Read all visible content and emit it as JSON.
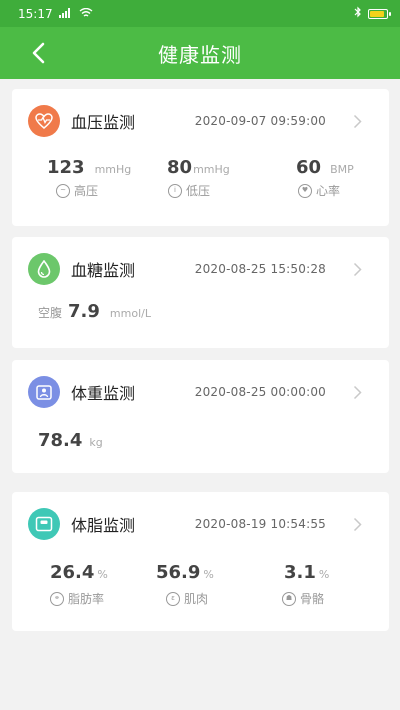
{
  "status_bar": {
    "time": "15:17",
    "signal_icon": "signal-icon",
    "wifi_icon": "wifi-icon",
    "bluetooth_icon": "bluetooth-icon",
    "battery_icon": "battery-icon",
    "battery_level": 0.85
  },
  "header": {
    "title": "健康监测",
    "back_icon": "chevron-left-icon"
  },
  "cards": {
    "blood_pressure": {
      "title": "血压监测",
      "time": "2020-09-07 09:59:00",
      "icon": "heartbeat-icon",
      "icon_color": "#f07a4a",
      "metrics": [
        {
          "value": "123",
          "unit": "mmHg",
          "label": "高压",
          "icon": "pulse-icon"
        },
        {
          "value": "80",
          "unit": "mmHg",
          "label": "低压",
          "icon": "thermometer-icon"
        },
        {
          "value": "60",
          "unit": "BMP",
          "label": "心率",
          "icon": "heart-circle-icon"
        }
      ]
    },
    "blood_sugar": {
      "title": "血糖监测",
      "time": "2020-08-25 15:50:28",
      "icon": "drop-icon",
      "icon_color": "#6cc76b",
      "prefix": "空腹",
      "value": "7.9",
      "unit": "mmol/L"
    },
    "weight": {
      "title": "体重监测",
      "time": "2020-08-25 00:00:00",
      "icon": "scale-person-icon",
      "icon_color": "#7b8fe4",
      "value": "78.4",
      "unit": "kg"
    },
    "body_fat": {
      "title": "体脂监测",
      "time": "2020-08-19 10:54:55",
      "icon": "scale-icon",
      "icon_color": "#3fc8b6",
      "metrics": [
        {
          "value": "26.4",
          "unit": "%",
          "label": "脂肪率",
          "icon": "fat-icon"
        },
        {
          "value": "56.9",
          "unit": "%",
          "label": "肌肉",
          "icon": "muscle-icon"
        },
        {
          "value": "3.1",
          "unit": "%",
          "label": "骨骼",
          "icon": "bone-icon"
        }
      ]
    }
  },
  "chevron_icon": "chevron-right-icon"
}
